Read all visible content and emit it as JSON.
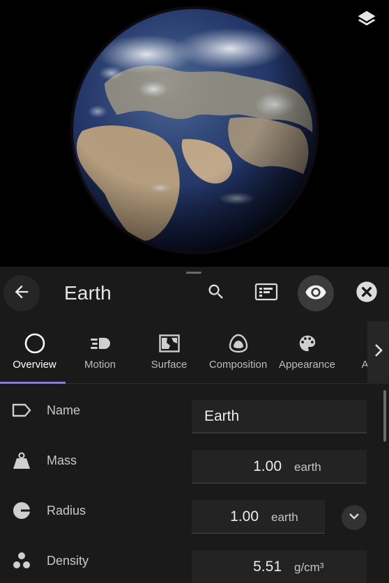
{
  "viewport": {
    "layers_icon": "layers-icon",
    "object_render": "earth-globe"
  },
  "header": {
    "back_icon": "arrow-left-icon",
    "title": "Earth",
    "search_icon": "search-icon",
    "info_icon": "info-panel-icon",
    "view_icon": "eye-icon",
    "close_icon": "close-icon"
  },
  "tabs": [
    {
      "label": "Overview",
      "icon": "circle-outline-icon",
      "active": true
    },
    {
      "label": "Motion",
      "icon": "motion-icon",
      "active": false
    },
    {
      "label": "Surface",
      "icon": "surface-map-icon",
      "active": false
    },
    {
      "label": "Composition",
      "icon": "composition-icon",
      "active": false
    },
    {
      "label": "Appearance",
      "icon": "palette-icon",
      "active": false
    },
    {
      "label": "Action",
      "icon": "action-icon",
      "active": false
    }
  ],
  "properties": [
    {
      "label": "Name",
      "icon": "tag-icon",
      "value": "Earth",
      "unit": ""
    },
    {
      "label": "Mass",
      "icon": "weight-icon",
      "value": "1.00",
      "unit": "earth"
    },
    {
      "label": "Radius",
      "icon": "radius-icon",
      "value": "1.00",
      "unit": "earth",
      "expandable": true
    },
    {
      "label": "Density",
      "icon": "density-icon",
      "value": "5.51",
      "unit": "g/cm³"
    }
  ],
  "colors": {
    "accent": "#8e7bd6",
    "panel_bg": "#1a1a1b",
    "field_bg": "#232324"
  }
}
